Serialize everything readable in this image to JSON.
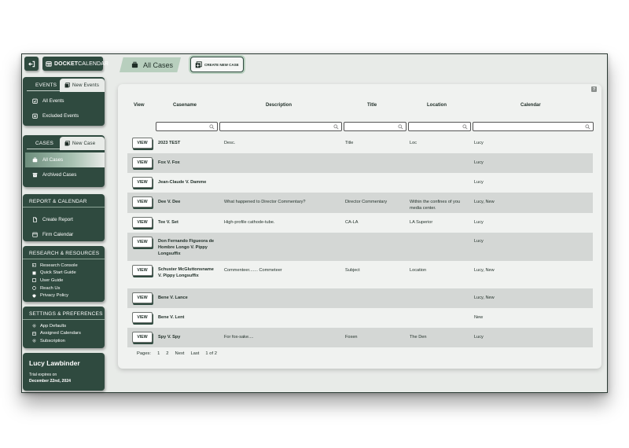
{
  "topbar": {
    "logo_bold": "DOCKET",
    "logo_light": "CALENDAR",
    "active_tab": "All Cases",
    "create_button": "CREATE NEW CASE"
  },
  "sidebar": {
    "events": {
      "heading": "EVENTS",
      "new_label": "New Events",
      "items": [
        "All Events",
        "Excluded Events"
      ]
    },
    "cases": {
      "heading": "CASES",
      "new_label": "New Case",
      "items": [
        "All Cases",
        "Archived Cases"
      ]
    },
    "report": {
      "heading": "REPORT & CALENDAR",
      "items": [
        "Create Report",
        "Firm Calendar"
      ]
    },
    "research": {
      "heading": "RESEARCH & RESOURCES",
      "items": [
        "Research Console",
        "Quick Start Guide",
        "User Guide",
        "Reach Us",
        "Privacy Policy"
      ]
    },
    "settings": {
      "heading": "SETTINGS & PREFERENCES",
      "items": [
        "App Defaults",
        "Assigned Calendars",
        "Subscription"
      ]
    },
    "user": {
      "name": "Lucy Lawbinder",
      "trial_label": "Trial expires on",
      "trial_date": "December 22nd, 2024"
    }
  },
  "table": {
    "help": "?",
    "headers": {
      "view": "View",
      "casename": "Casename",
      "description": "Description",
      "title": "Title",
      "location": "Location",
      "calendar": "Calendar"
    },
    "view_label": "VIEW",
    "rows": [
      {
        "name": "2023 TEST",
        "description": "Desc.",
        "title": "Title",
        "location": "Loc",
        "calendar": "Lucy"
      },
      {
        "name": "Fox V. Fox",
        "description": "",
        "title": "",
        "location": "",
        "calendar": "Lucy"
      },
      {
        "name": "Jean-Claude V. Damme",
        "description": "",
        "title": "",
        "location": "",
        "calendar": "Lucy"
      },
      {
        "name": "Dee V. Dee",
        "description": "What happened to Director Commentary?",
        "title": "Director Commentary",
        "location": "Within the confines of you media center.",
        "calendar": "Lucy, New"
      },
      {
        "name": "Tee V. Set",
        "description": "High-profile cathode-tube.",
        "title": "CA-LA",
        "location": "LA Superior",
        "calendar": "Lucy"
      },
      {
        "name": "Don Fernando Figueora de Hombre Longo V. Pippy Longsuffix",
        "description": "",
        "title": "",
        "location": "",
        "calendar": "Lucy"
      },
      {
        "name": "Schuster McGluttonsname V. Pippy Longsuffix",
        "description": "Commenteer....... Commeteer",
        "title": "Subject",
        "location": "Location",
        "calendar": "Lucy, New"
      },
      {
        "name": "Bene V. Lance",
        "description": "",
        "title": "",
        "location": "",
        "calendar": "Lucy, New"
      },
      {
        "name": "Bene V. Lent",
        "description": "",
        "title": "",
        "location": "",
        "calendar": "New"
      },
      {
        "name": "Spy V. Spy",
        "description": "For fox-sake....",
        "title": "Foxen",
        "location": "The Den",
        "calendar": "Lucy"
      }
    ],
    "pager": {
      "label": "Pages:",
      "page1": "1",
      "page2": "2",
      "next": "Next",
      "last": "Last",
      "summary": "1 of 2"
    }
  }
}
